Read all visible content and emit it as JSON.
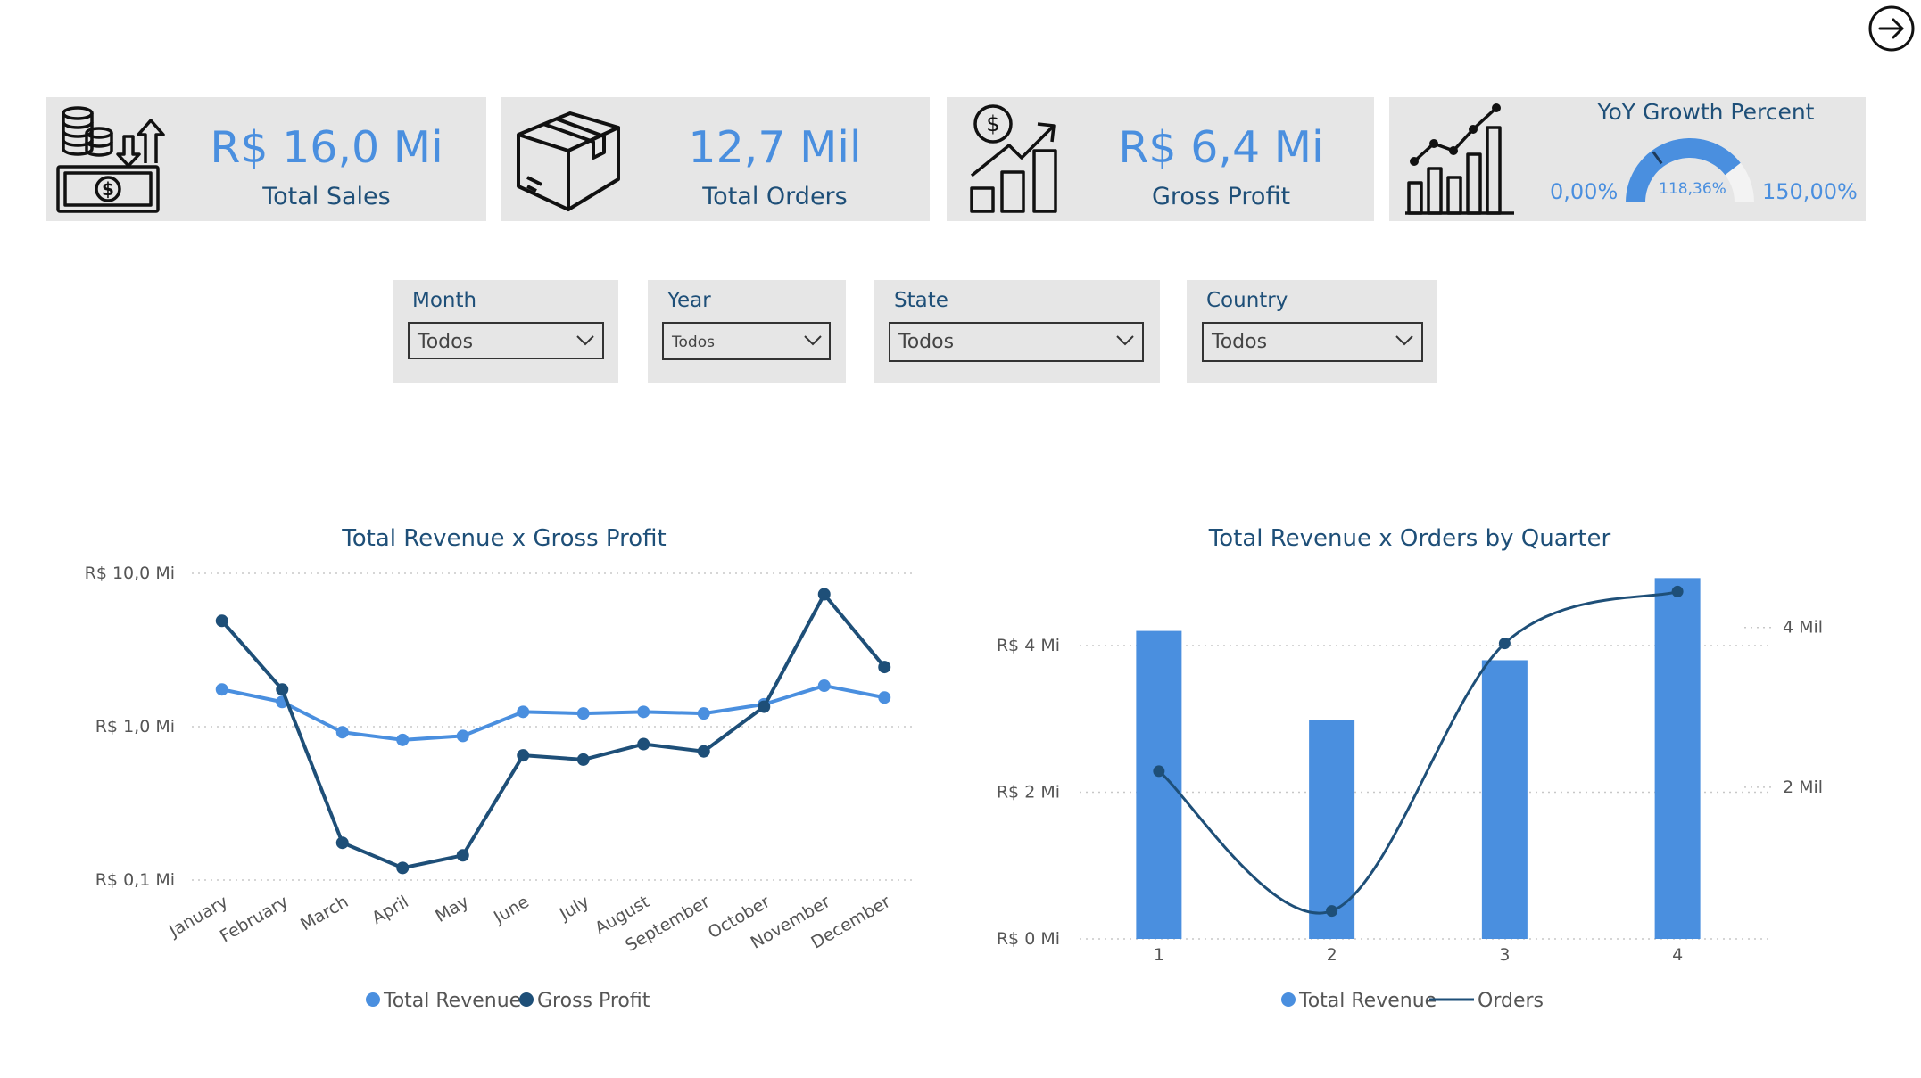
{
  "nav": {
    "next_icon": "arrow-right-circle-icon"
  },
  "kpis": [
    {
      "value": "R$ 16,0 Mi",
      "label": "Total Sales",
      "icon": "money-coins-icon"
    },
    {
      "value": "12,7 Mil",
      "label": "Total Orders",
      "icon": "package-box-icon"
    },
    {
      "value": "R$ 6,4 Mi",
      "label": "Gross Profit",
      "icon": "growth-chart-dollar-icon"
    }
  ],
  "yoy": {
    "title": "YoY Growth Percent",
    "min_label": "0,00%",
    "max_label": "150,00%",
    "value_label": "118,36%",
    "value": 118.36,
    "min": 0,
    "max": 150,
    "icon": "bar-line-chart-icon"
  },
  "filters": [
    {
      "label": "Month",
      "value": "Todos"
    },
    {
      "label": "Year",
      "value": "Todos"
    },
    {
      "label": "State",
      "value": "Todos"
    },
    {
      "label": "Country",
      "value": "Todos"
    }
  ],
  "colors": {
    "accent": "#4a8fdf",
    "dark": "#1e4f78",
    "card_bg": "#e6e6e6"
  },
  "chart_data": [
    {
      "type": "line",
      "title": "Total Revenue x Gross Profit",
      "scale": "log",
      "categories": [
        "January",
        "February",
        "March",
        "April",
        "May",
        "June",
        "July",
        "August",
        "September",
        "October",
        "November",
        "December"
      ],
      "y_ticks": [
        {
          "value": 10,
          "label": "R$ 10,0 Mi"
        },
        {
          "value": 1,
          "label": "R$ 1,0 Mi"
        },
        {
          "value": 0.1,
          "label": "R$ 0,1 Mi"
        }
      ],
      "ylim": [
        0.1,
        10
      ],
      "series": [
        {
          "name": "Total Revenue",
          "color": "#4a8fdf",
          "values": [
            1.75,
            1.45,
            0.92,
            0.82,
            0.87,
            1.25,
            1.22,
            1.25,
            1.22,
            1.4,
            1.85,
            1.55
          ]
        },
        {
          "name": "Gross Profit",
          "color": "#1e4f78",
          "values": [
            4.9,
            1.75,
            0.175,
            0.12,
            0.145,
            0.65,
            0.61,
            0.77,
            0.69,
            1.35,
            7.3,
            2.45
          ]
        }
      ],
      "legend": "bottom",
      "grid": true
    },
    {
      "type": "bar",
      "title": "Total Revenue x Orders by Quarter",
      "categories": [
        "1",
        "2",
        "3",
        "4"
      ],
      "y_ticks": [
        {
          "value": 4,
          "label": "R$ 4 Mi"
        },
        {
          "value": 2,
          "label": "R$ 2 Mi"
        },
        {
          "value": 0,
          "label": "R$ 0 Mi"
        }
      ],
      "ylim": [
        0,
        4.9
      ],
      "y2_ticks": [
        {
          "value": 4,
          "label": "4 Mil"
        },
        {
          "value": 2,
          "label": "2 Mil"
        }
      ],
      "y2lim": [
        0.1,
        4.6
      ],
      "series": [
        {
          "name": "Total Revenue",
          "type": "bar",
          "color": "#4a8fdf",
          "values": [
            4.2,
            2.98,
            3.8,
            4.92
          ]
        },
        {
          "name": "Orders",
          "type": "line",
          "color": "#1e4f78",
          "values": [
            2.2,
            0.45,
            3.8,
            4.45
          ]
        }
      ],
      "legend": "bottom",
      "grid": true
    }
  ]
}
